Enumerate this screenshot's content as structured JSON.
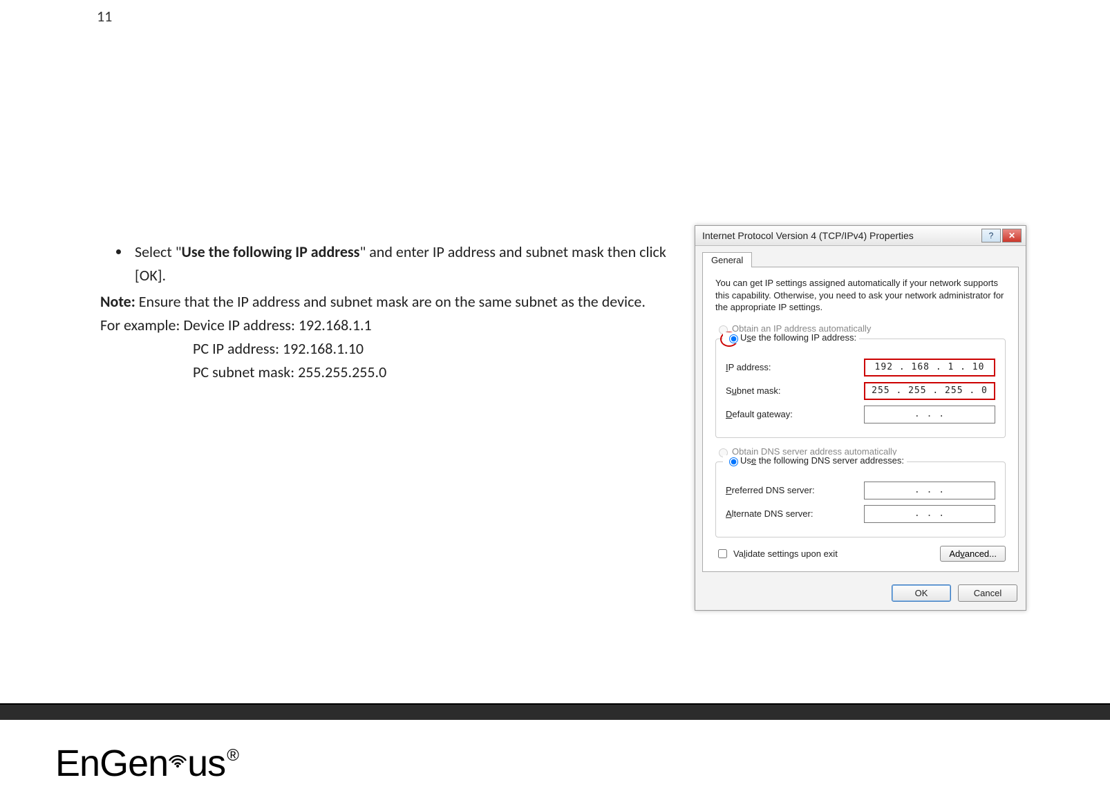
{
  "page_number": "11",
  "instructions": {
    "bullet_prefix": "Select \"",
    "bullet_bold": "Use the following IP address",
    "bullet_suffix": "\" and enter IP address and subnet mask then click [OK].",
    "note_label": "Note:",
    "note_text": " Ensure that the IP address and subnet mask are on the same subnet as the device.",
    "example_line": "For example: Device IP address: 192.168.1.1",
    "pc_ip_line": "PC IP address: 192.168.1.10",
    "pc_mask_line": "PC subnet mask: 255.255.255.0"
  },
  "dialog": {
    "title": "Internet Protocol Version 4 (TCP/IPv4) Properties",
    "tab": "General",
    "description": "You can get IP settings assigned automatically if your network supports this capability. Otherwise, you need to ask your network administrator for the appropriate IP settings.",
    "radio_auto_ip": "Obtain an IP address automatically",
    "radio_static_ip": "Use the following IP address:",
    "ip_label": "IP address:",
    "ip_value": "192 . 168 .  1  .  10",
    "mask_label": "Subnet mask:",
    "mask_value": "255 . 255 . 255 .  0",
    "gw_label": "Default gateway:",
    "gw_value": ".       .       .",
    "radio_auto_dns": "Obtain DNS server address automatically",
    "radio_static_dns": "Use the following DNS server addresses:",
    "pref_dns_label": "Preferred DNS server:",
    "pref_dns_value": ".       .       .",
    "alt_dns_label": "Alternate DNS server:",
    "alt_dns_value": ".       .       .",
    "validate_label": "Validate settings upon exit",
    "advanced_btn": "Advanced...",
    "ok_btn": "OK",
    "cancel_btn": "Cancel"
  },
  "logo": {
    "text_en": "En",
    "text_gen": "Gen",
    "text_us": "us",
    "reg": "®"
  }
}
